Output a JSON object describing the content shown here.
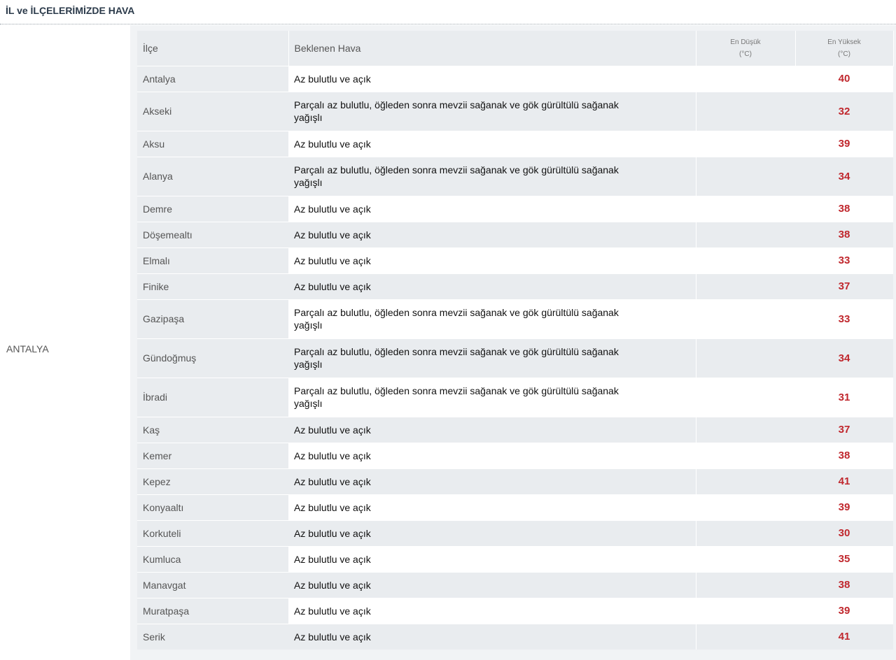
{
  "header": {
    "title": "İL ve İLÇELERİMİZDE HAVA"
  },
  "province": "ANTALYA",
  "table": {
    "columns": {
      "district": "İlçe",
      "weather": "Beklenen Hava",
      "min_line1": "En Düşük",
      "min_line2": "(°C)",
      "max_line1": "En Yüksek",
      "max_line2": "(°C)"
    },
    "rows": [
      {
        "district": "Antalya",
        "weather_l1": "Az bulutlu ve açık",
        "weather_l2": "",
        "min": "",
        "max": "40"
      },
      {
        "district": "Akseki",
        "weather_l1": "Parçalı az bulutlu, öğleden sonra mevzii sağanak ve gök gürültülü sağanak",
        "weather_l2": "yağışlı",
        "min": "",
        "max": "32"
      },
      {
        "district": "Aksu",
        "weather_l1": "Az bulutlu ve açık",
        "weather_l2": "",
        "min": "",
        "max": "39"
      },
      {
        "district": "Alanya",
        "weather_l1": "Parçalı az bulutlu, öğleden sonra mevzii sağanak ve gök gürültülü sağanak",
        "weather_l2": "yağışlı",
        "min": "",
        "max": "34"
      },
      {
        "district": "Demre",
        "weather_l1": "Az bulutlu ve açık",
        "weather_l2": "",
        "min": "",
        "max": "38"
      },
      {
        "district": "Döşemealtı",
        "weather_l1": "Az bulutlu ve açık",
        "weather_l2": "",
        "min": "",
        "max": "38"
      },
      {
        "district": "Elmalı",
        "weather_l1": "Az bulutlu ve açık",
        "weather_l2": "",
        "min": "",
        "max": "33"
      },
      {
        "district": "Finike",
        "weather_l1": "Az bulutlu ve açık",
        "weather_l2": "",
        "min": "",
        "max": "37"
      },
      {
        "district": "Gazipaşa",
        "weather_l1": "Parçalı az bulutlu, öğleden sonra mevzii sağanak ve gök gürültülü sağanak",
        "weather_l2": "yağışlı",
        "min": "",
        "max": "33"
      },
      {
        "district": "Gündoğmuş",
        "weather_l1": "Parçalı az bulutlu, öğleden sonra mevzii sağanak ve gök gürültülü sağanak",
        "weather_l2": "yağışlı",
        "min": "",
        "max": "34"
      },
      {
        "district": "İbradi",
        "weather_l1": "Parçalı az bulutlu, öğleden sonra mevzii sağanak ve gök gürültülü sağanak",
        "weather_l2": "yağışlı",
        "min": "",
        "max": "31"
      },
      {
        "district": "Kaş",
        "weather_l1": "Az bulutlu ve açık",
        "weather_l2": "",
        "min": "",
        "max": "37"
      },
      {
        "district": "Kemer",
        "weather_l1": "Az bulutlu ve açık",
        "weather_l2": "",
        "min": "",
        "max": "38"
      },
      {
        "district": "Kepez",
        "weather_l1": "Az bulutlu ve açık",
        "weather_l2": "",
        "min": "",
        "max": "41"
      },
      {
        "district": "Konyaaltı",
        "weather_l1": "Az bulutlu ve açık",
        "weather_l2": "",
        "min": "",
        "max": "39"
      },
      {
        "district": "Korkuteli",
        "weather_l1": "Az bulutlu ve açık",
        "weather_l2": "",
        "min": "",
        "max": "30"
      },
      {
        "district": "Kumluca",
        "weather_l1": "Az bulutlu ve açık",
        "weather_l2": "",
        "min": "",
        "max": "35"
      },
      {
        "district": "Manavgat",
        "weather_l1": "Az bulutlu ve açık",
        "weather_l2": "",
        "min": "",
        "max": "38"
      },
      {
        "district": "Muratpaşa",
        "weather_l1": "Az bulutlu ve açık",
        "weather_l2": "",
        "min": "",
        "max": "39"
      },
      {
        "district": "Serik",
        "weather_l1": "Az bulutlu ve açık",
        "weather_l2": "",
        "min": "",
        "max": "41"
      }
    ]
  },
  "colors": {
    "max_temp": "#c0272d",
    "row_alt": "#e9ecef",
    "page_bg": "#f1f3f5"
  }
}
